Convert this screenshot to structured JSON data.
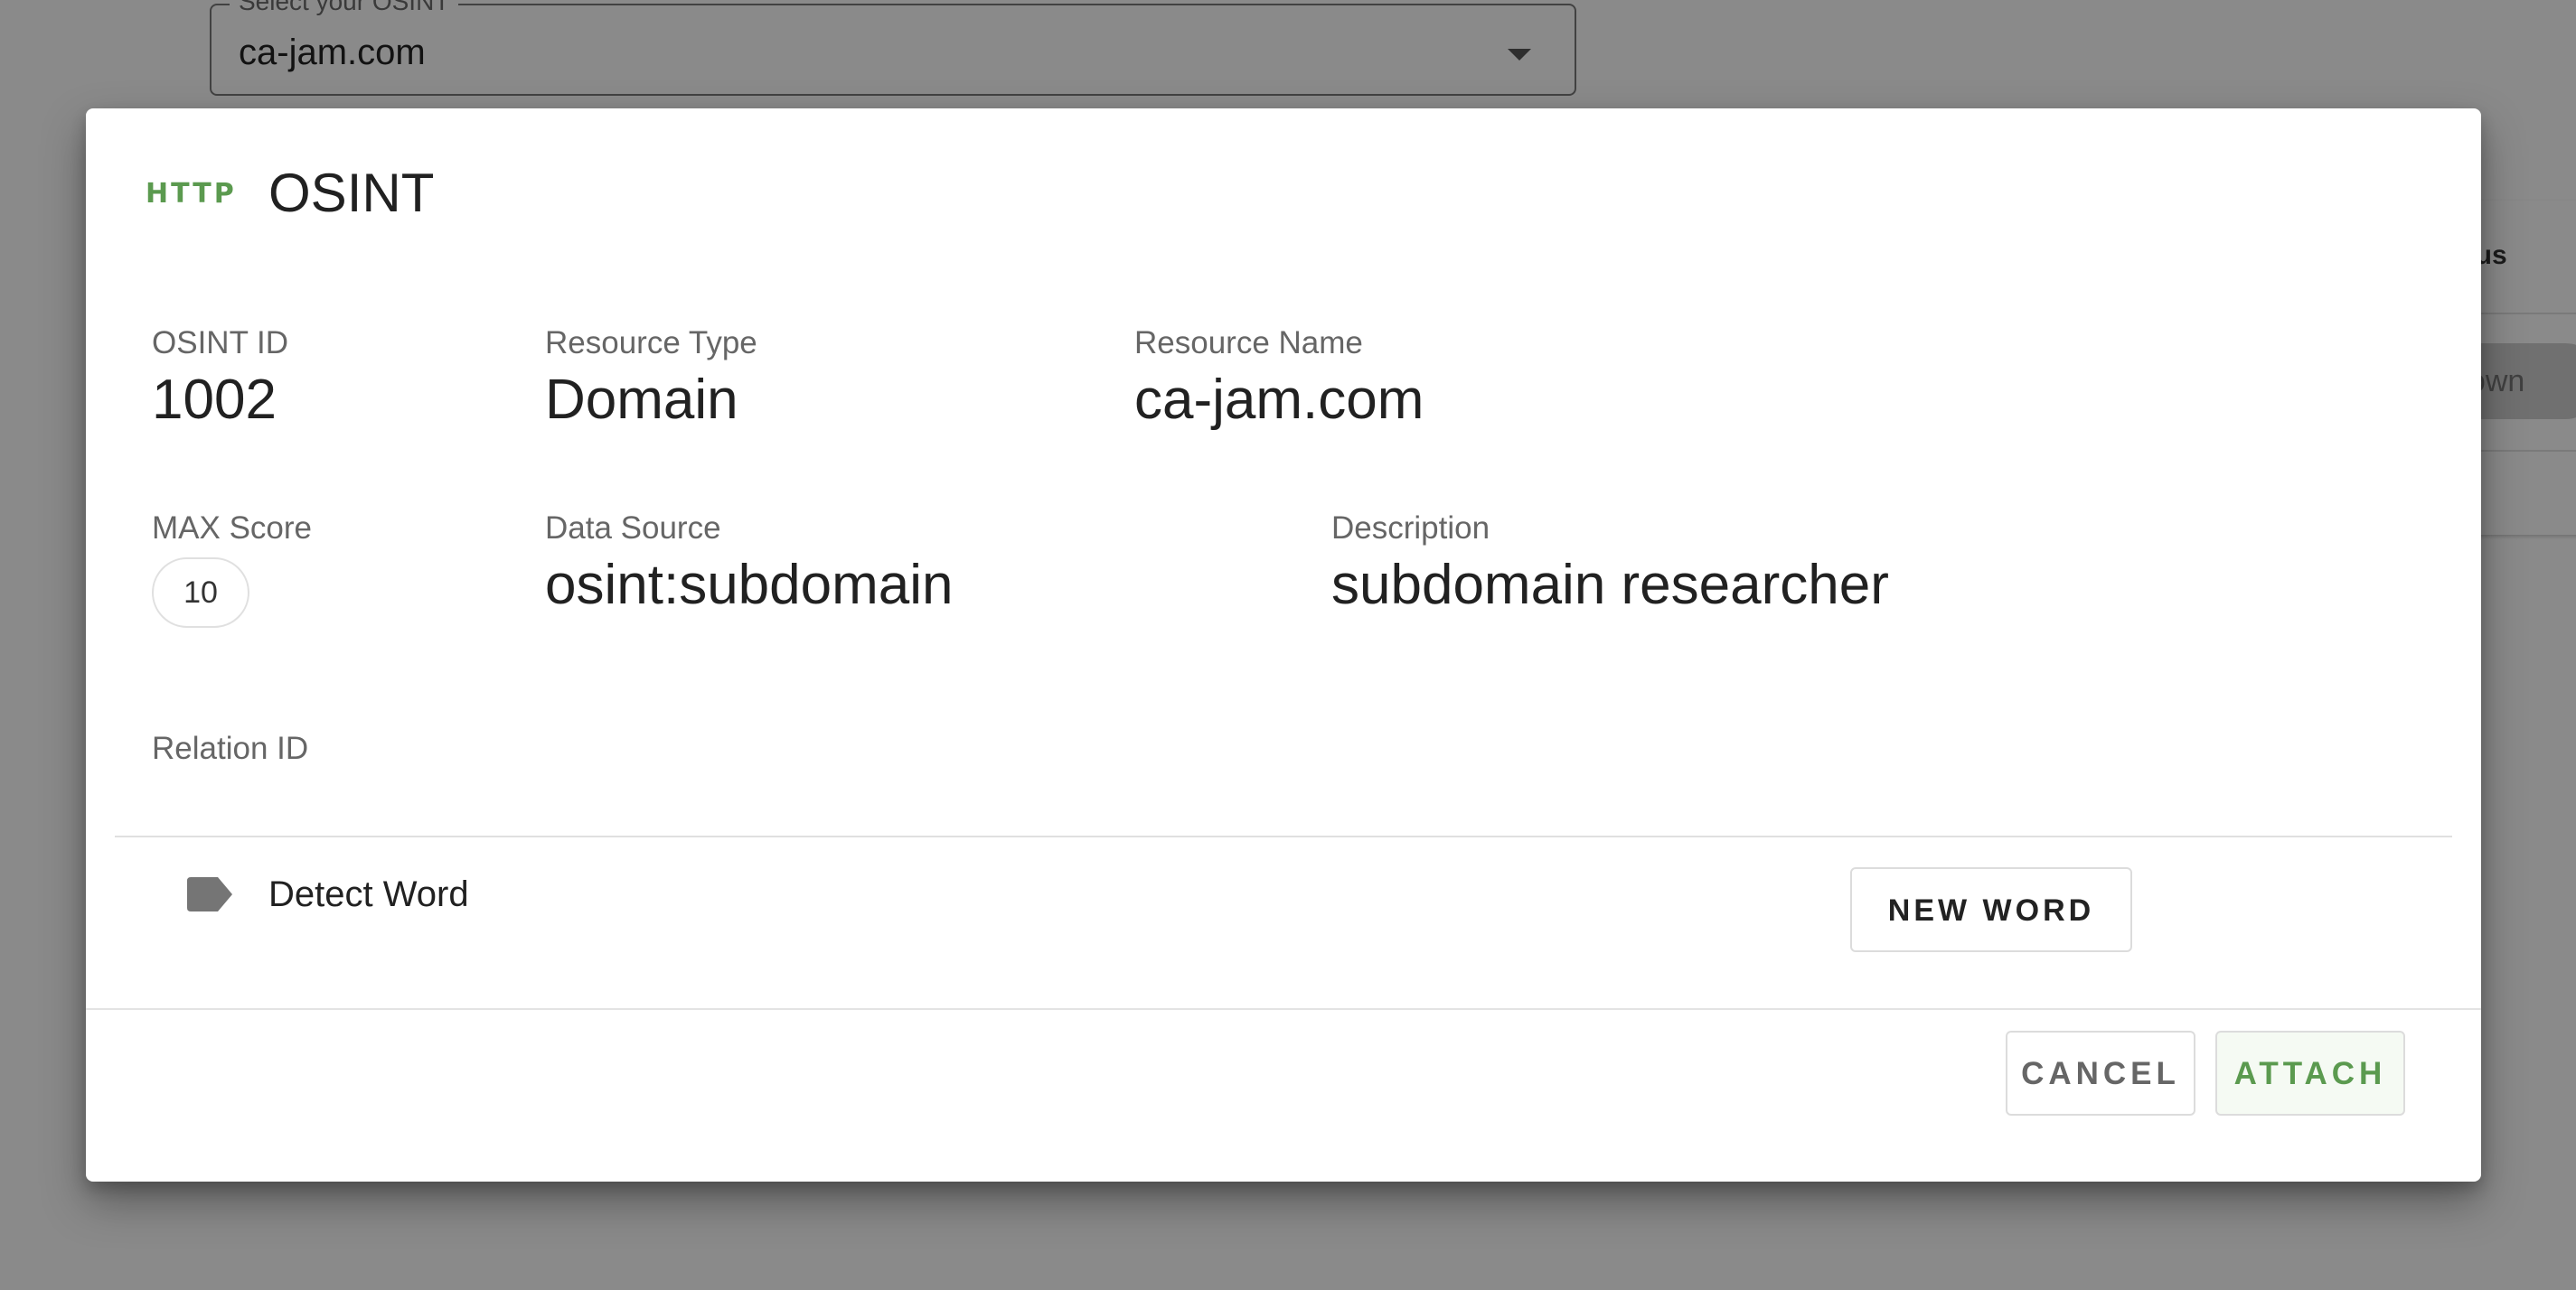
{
  "background": {
    "osint_select": {
      "label": "Select your OSINT",
      "value": "ca-jam.com"
    },
    "table": {
      "status_header": "atus",
      "status_chip": "nown"
    }
  },
  "dialog": {
    "icon_text": "HTTP",
    "title": "OSINT",
    "fields": {
      "osint_id": {
        "label": "OSINT ID",
        "value": "1002"
      },
      "resource_type": {
        "label": "Resource Type",
        "value": "Domain"
      },
      "resource_name": {
        "label": "Resource Name",
        "value": "ca-jam.com"
      },
      "max_score": {
        "label": "MAX Score",
        "value": "10"
      },
      "data_source": {
        "label": "Data Source",
        "value": "osint:subdomain"
      },
      "description": {
        "label": "Description",
        "value": "subdomain researcher"
      },
      "relation_id": {
        "label": "Relation ID",
        "value": ""
      }
    },
    "detect_word": {
      "icon": "label-icon",
      "label": "Detect Word"
    },
    "new_word_button": "NEW WORD",
    "cancel_button": "CANCEL",
    "attach_button": "ATTACH"
  },
  "colors": {
    "accent": "#5b9a4f",
    "scrim": "rgba(0,0,0,0.46)"
  }
}
